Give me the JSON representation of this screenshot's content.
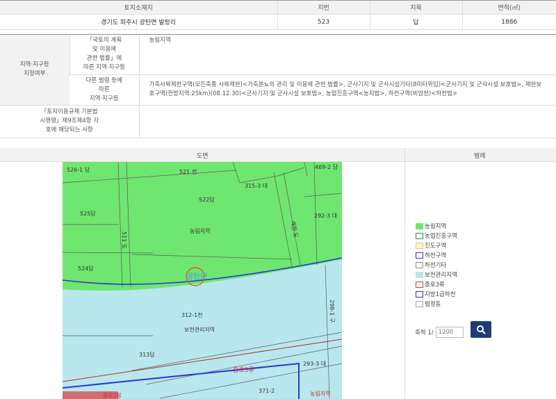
{
  "land": {
    "headers": [
      "토지소재지",
      "지번",
      "지목",
      "면적(㎡)"
    ],
    "values": [
      "경기도 파주시 광탄면 발랑리",
      "523",
      "답",
      "1886"
    ]
  },
  "zoning": {
    "main_label": "지역·지구등\n지정여부",
    "sub1_label": "「국토의 계획\n및 이용에\n관한 법률」에\n따른 지역·지구등",
    "sub1_value": "농림지역",
    "sub2_label": "다른 법령 등에\n따른\n지역·지구등",
    "sub2_value": "가축사육제한구역(모든축종 사육제한)<가축분뇨의 관리 및 이용에 관한 법률>, 군사기지 및 군사시설기타(8미터위임)<군사기지 및 군사시설 보호법>, 제한보호구역(전방지역:25km)(08.12.30)<군사기지 및 군사시설 보호법>, 농업진흥구역<농지법>, 하천구역(비암천)<하천법>",
    "row3_label": "「토지이용규제 기본법\n시행령」제9조제4항 각\n호에 해당되는 사항",
    "row3_value": ""
  },
  "map_section": {
    "title": "도면",
    "legend_title": "범례"
  },
  "map_labels": {
    "p5261": "526-1 답",
    "p521": "521 전",
    "p4692": "469-2 답",
    "p3153": "315-3 대",
    "p525": "525답",
    "p511": "511 도",
    "p522": "522답",
    "nongrim": "농림지역",
    "road": "세천 도",
    "p2923": "292-3 대",
    "p524": "524답",
    "gwangtan": "광탄면",
    "p3121": "312-1천",
    "p2981": "298-1 구",
    "bogwan": "보전관리지역",
    "p313": "313답",
    "road3": "중로3류",
    "p2933": "293-3 대",
    "p3712": "371-2",
    "bottom_left": "중로3류",
    "bottom_right": "농림지역"
  },
  "legend": [
    {
      "label": "농림지역",
      "color": "#6fe66f"
    },
    {
      "label": "농업진흥구역",
      "color": "#ffffff",
      "border": "#3a8a3a"
    },
    {
      "label": "진도구역",
      "color": "#fff7c8",
      "border": "#d8c870"
    },
    {
      "label": "하천구역",
      "color": "#ffffff",
      "border": "#2a3aa8"
    },
    {
      "label": "하천기타",
      "color": "#ffffff",
      "border": "#888888"
    },
    {
      "label": "보전관리지역",
      "color": "#b9e7ee"
    },
    {
      "label": "중로3류",
      "color": "#ffffff",
      "border": "#d33a3a"
    },
    {
      "label": "지방1급하천",
      "color": "#ffffff",
      "border": "#3b2aa8"
    },
    {
      "label": "법정동",
      "color": "#ffffff",
      "border": "#aaaaaa"
    }
  ],
  "scale": {
    "label": "축척 1/",
    "placeholder": "1200"
  }
}
